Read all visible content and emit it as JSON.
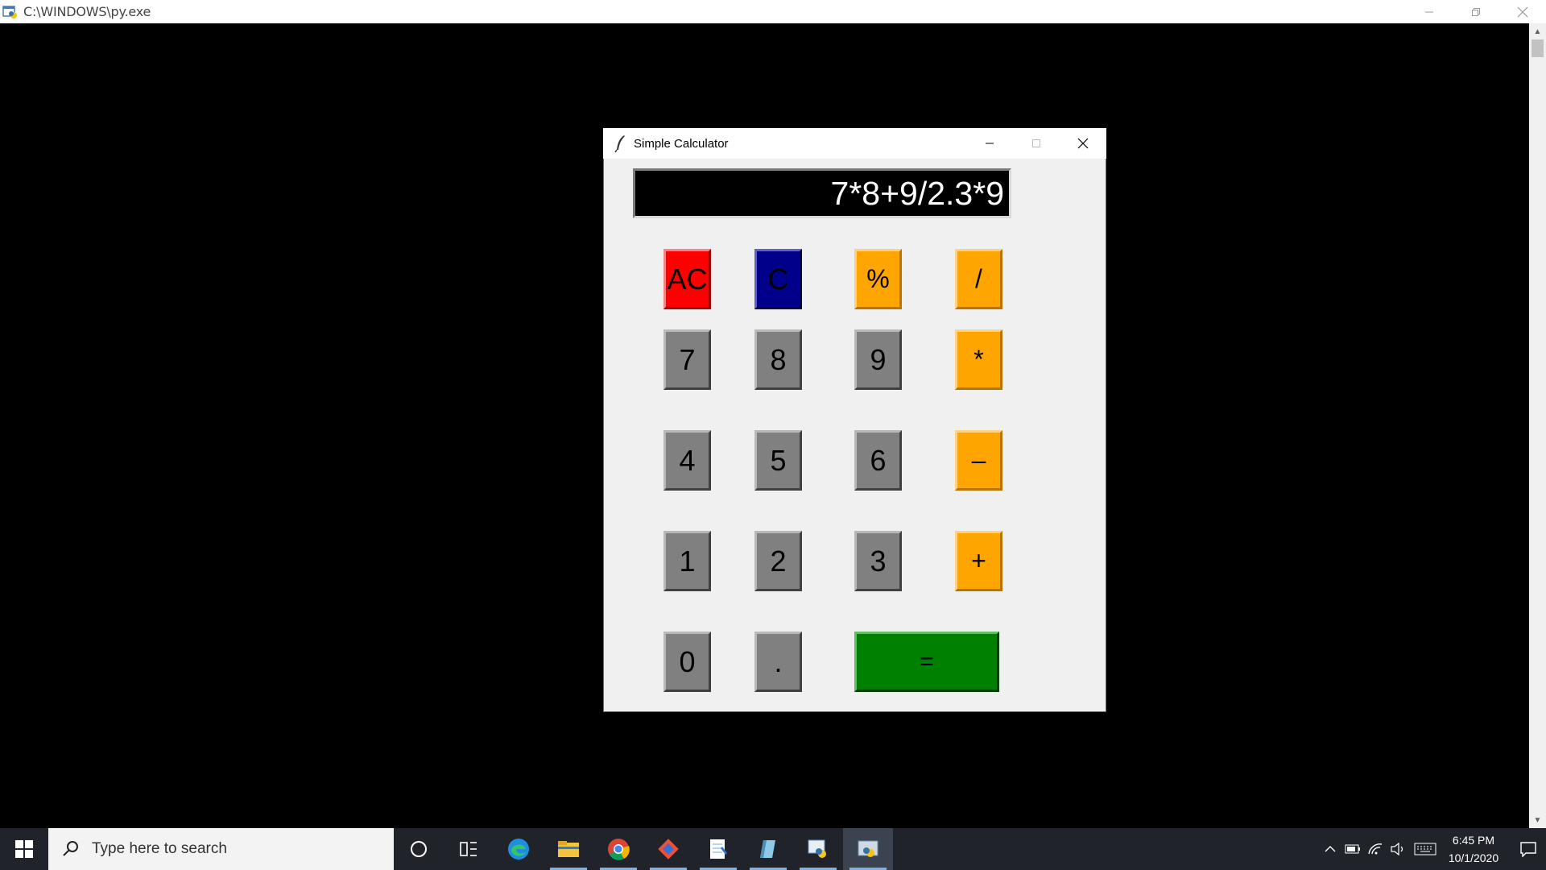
{
  "console": {
    "title": "C:\\WINDOWS\\py.exe"
  },
  "calculator": {
    "title": "Simple Calculator",
    "display": "7*8+9/2.3*9",
    "keys": {
      "ac": "AC",
      "c": "C",
      "percent": "%",
      "divide": "/",
      "seven": "7",
      "eight": "8",
      "nine": "9",
      "multiply": "*",
      "four": "4",
      "five": "5",
      "six": "6",
      "minus": "–",
      "one": "1",
      "two": "2",
      "three": "3",
      "plus": "+",
      "zero": "0",
      "dot": ".",
      "equals": "="
    },
    "colors": {
      "ac": "#ff0000",
      "c": "#00008b",
      "operator": "#ffa500",
      "digit": "#808080",
      "equals": "#008000"
    }
  },
  "taskbar": {
    "search_placeholder": "Type here to search",
    "apps": [
      "cortana-icon",
      "task-view-icon",
      "edge-icon",
      "file-explorer-icon",
      "chrome-icon",
      "git-icon",
      "notepad-icon",
      "app-icon",
      "python-launcher-icon",
      "python-icon"
    ],
    "time": "6:45 PM",
    "date": "10/1/2020"
  }
}
